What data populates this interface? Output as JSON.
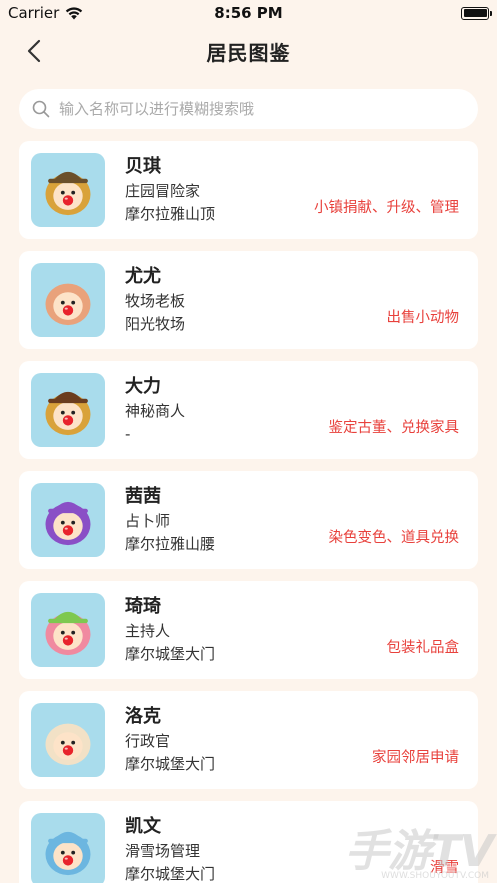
{
  "status_bar": {
    "carrier": "Carrier",
    "time": "8:56 PM"
  },
  "nav": {
    "title": "居民图鉴",
    "back_icon": "chevron-left-icon"
  },
  "search": {
    "placeholder": "输入名称可以进行模糊搜索哦",
    "value": ""
  },
  "residents": [
    {
      "name": "贝琪",
      "role": "庄园冒险家",
      "place": "摩尔拉雅山顶",
      "service": "小镇捐献、升级、管理",
      "hair": "#d9a23a",
      "hat": "#6b4f2a"
    },
    {
      "name": "尤尤",
      "role": "牧场老板",
      "place": "阳光牧场",
      "service": "出售小动物",
      "hair": "#e9a27b",
      "hat": ""
    },
    {
      "name": "大力",
      "role": "神秘商人",
      "place": "-",
      "service": "鉴定古董、兑换家具",
      "hair": "#d9a23a",
      "hat": "#6b3d1e"
    },
    {
      "name": "茜茜",
      "role": "占卜师",
      "place": "摩尔拉雅山腰",
      "service": "染色变色、道具兑换",
      "hair": "#8a4fc6",
      "hat": "#8a4fc6"
    },
    {
      "name": "琦琦",
      "role": "主持人",
      "place": "摩尔城堡大门",
      "service": "包装礼品盒",
      "hair": "#f08aa0",
      "hat": "#7ec850"
    },
    {
      "name": "洛克",
      "role": "行政官",
      "place": "摩尔城堡大门",
      "service": "家园邻居申请",
      "hair": "#f2e1c6",
      "hat": ""
    },
    {
      "name": "凯文",
      "role": "滑雪场管理",
      "place": "摩尔城堡大门",
      "service": "滑雪",
      "hair": "#6cb6e0",
      "hat": "#6cb6e0"
    }
  ],
  "watermark": {
    "main": "手游TV",
    "sub": "WWW.SHOUYOUTV.COM"
  }
}
